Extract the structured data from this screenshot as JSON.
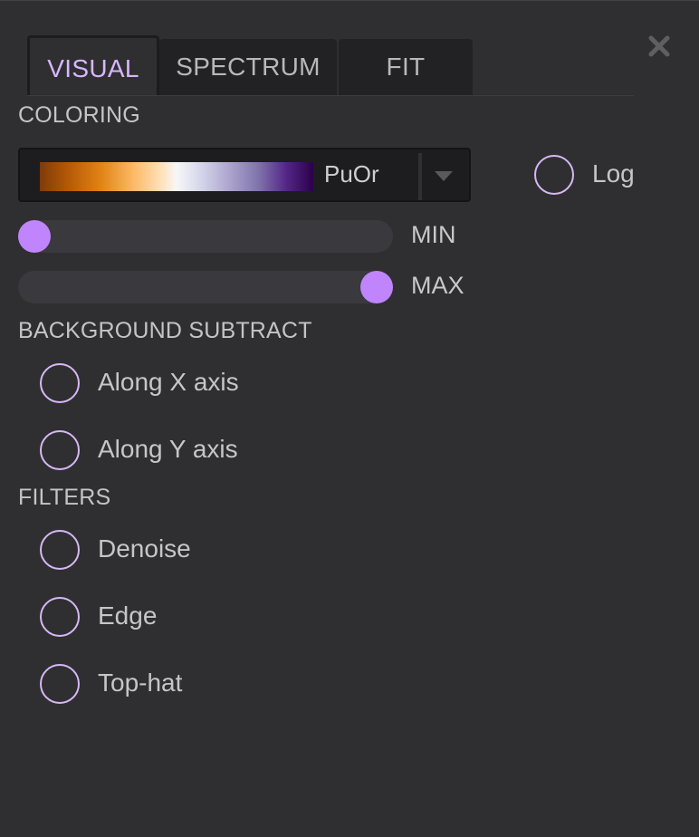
{
  "tabs": [
    {
      "label": "VISUAL",
      "active": true
    },
    {
      "label": "SPECTRUM",
      "active": false
    },
    {
      "label": "FIT",
      "active": false
    }
  ],
  "close_icon": "close-x-icon",
  "coloring": {
    "section_label": "COLORING",
    "colormap": "PuOr",
    "colormap_colors": [
      "#7f3b08",
      "#e08214",
      "#fdb863",
      "#f7f7f7",
      "#b2abd2",
      "#542788",
      "#2d004b"
    ],
    "log_label": "Log",
    "log_checked": false,
    "min_label": "MIN",
    "max_label": "MAX",
    "min_value_fraction": 0.0,
    "max_value_fraction": 1.0
  },
  "background_subtract": {
    "section_label": "BACKGROUND SUBTRACT",
    "options": [
      {
        "label": "Along X axis",
        "checked": false
      },
      {
        "label": "Along Y axis",
        "checked": false
      }
    ]
  },
  "filters": {
    "section_label": "FILTERS",
    "options": [
      {
        "label": "Denoise",
        "checked": false
      },
      {
        "label": "Edge",
        "checked": false
      },
      {
        "label": "Top-hat",
        "checked": false
      }
    ]
  },
  "colors": {
    "accent": "#c084fc",
    "radio_border": "#d6b8f5",
    "active_tab_text": "#d7b6ff",
    "background": "#2f2f31"
  }
}
